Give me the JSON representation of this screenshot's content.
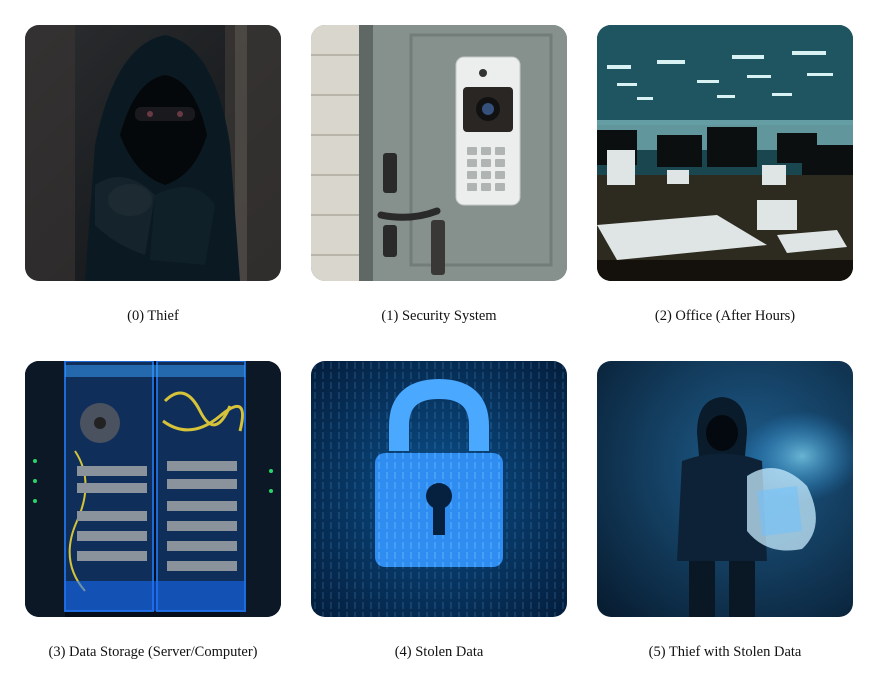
{
  "panels": [
    {
      "caption": "(0) Thief",
      "icon": "hooded-thief-image"
    },
    {
      "caption": "(1) Security System",
      "icon": "keypad-door-lock-image"
    },
    {
      "caption": "(2) Office (After Hours)",
      "icon": "dark-office-image"
    },
    {
      "caption": "(3) Data Storage (Server/Computer)",
      "icon": "server-rack-image"
    },
    {
      "caption": "(4) Stolen Data",
      "icon": "digital-padlock-image"
    },
    {
      "caption": "(5) Thief with Stolen Data",
      "icon": "thief-with-bag-image"
    }
  ]
}
